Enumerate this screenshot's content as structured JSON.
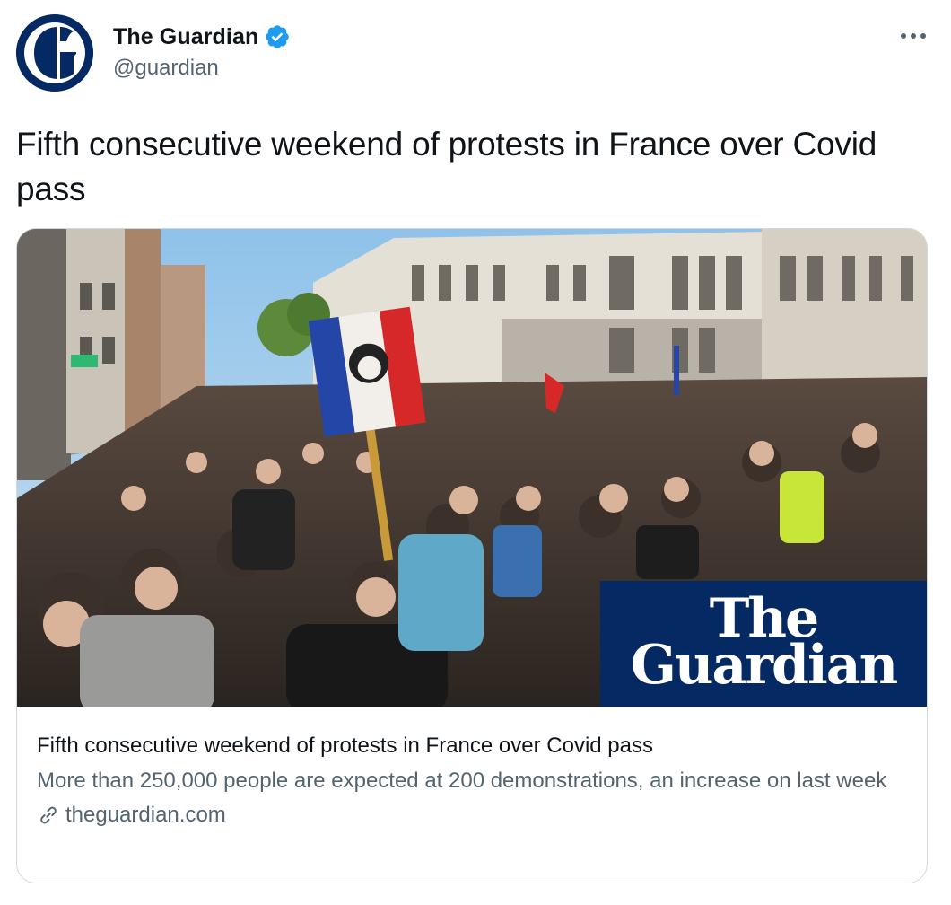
{
  "account": {
    "display_name": "The Guardian",
    "handle": "@guardian",
    "avatar_letter": "G",
    "verified": true,
    "avatar_color": "#052962",
    "verified_color": "#1d9bf0"
  },
  "tweet": {
    "text": "Fifth consecutive weekend of protests in France over Covid pass"
  },
  "menu": {
    "icon": "more-dots-icon"
  },
  "card": {
    "image_description_icon": "protest-photo",
    "logo_line1": "The",
    "logo_line2": "Guardian",
    "title": "Fifth consecutive weekend of protests in France over Covid pass",
    "description": "More than 250,000 people are expected at 200 demonstrations, an increase on last week",
    "domain": "theguardian.com",
    "domain_icon": "link-icon"
  },
  "colors": {
    "text_primary": "#0f1419",
    "text_secondary": "#536471",
    "border": "#cfd9de",
    "guardian_blue": "#052962"
  }
}
